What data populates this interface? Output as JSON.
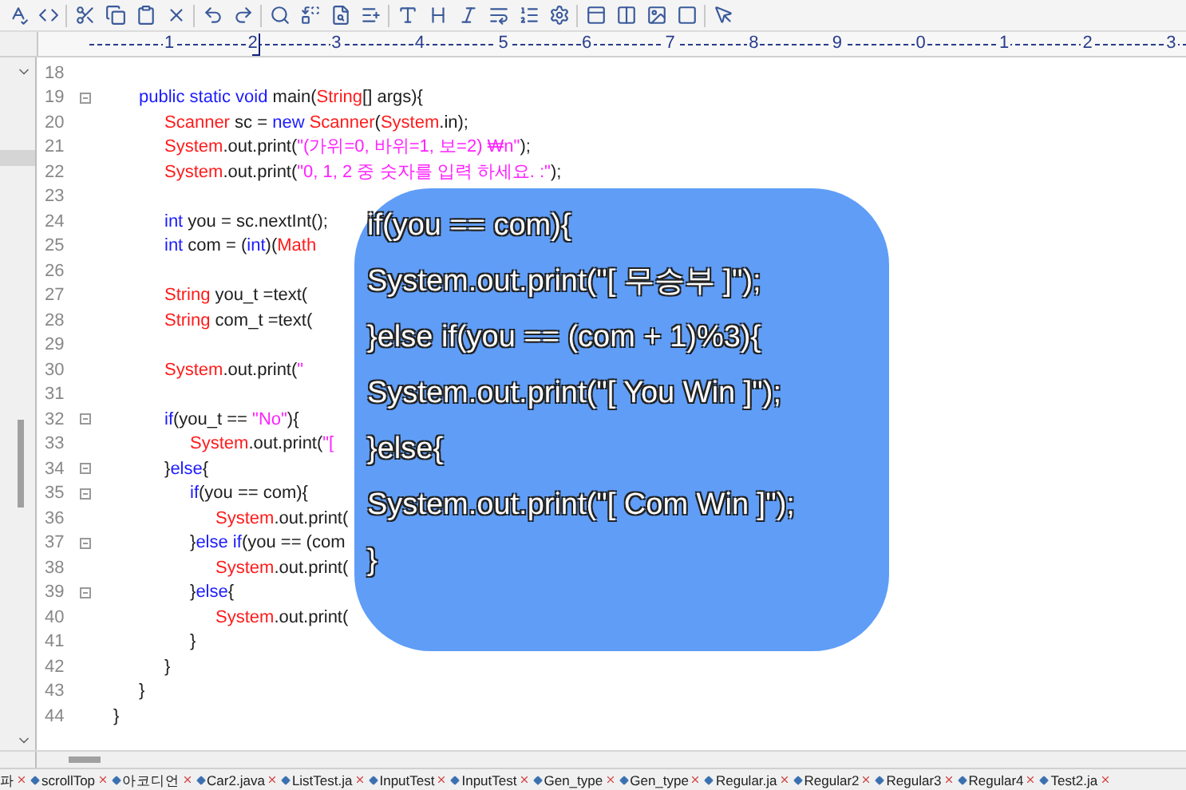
{
  "ruler": {
    "labels": [
      "1",
      "2",
      "3",
      "4",
      "5",
      "6",
      "7",
      "8",
      "9",
      "0",
      "1",
      "2",
      "3"
    ]
  },
  "code_lines": [
    {
      "number": "18",
      "fold": false
    },
    {
      "number": "19",
      "fold": true,
      "tokens": [
        {
          "kind": "keyword",
          "text": "\tpublic static void"
        },
        {
          "kind": "plain",
          "text": " main("
        },
        {
          "kind": "class",
          "text": "String"
        },
        {
          "kind": "plain",
          "text": "[] args){"
        }
      ]
    },
    {
      "number": "20",
      "fold": false,
      "tokens": [
        {
          "kind": "class",
          "text": "\t\tScanner"
        },
        {
          "kind": "plain",
          "text": " sc = "
        },
        {
          "kind": "keyword",
          "text": "new"
        },
        {
          "kind": "class",
          "text": " Scanner"
        },
        {
          "kind": "plain",
          "text": "("
        },
        {
          "kind": "class",
          "text": "System"
        },
        {
          "kind": "plain",
          "text": ".in);"
        }
      ]
    },
    {
      "number": "21",
      "fold": false,
      "tokens": [
        {
          "kind": "class",
          "text": "\t\tSystem"
        },
        {
          "kind": "plain",
          "text": ".out.print("
        },
        {
          "kind": "string",
          "text": "\"(가위=0, 바위=1, 보=2) ₩n\""
        },
        {
          "kind": "plain",
          "text": ");"
        }
      ]
    },
    {
      "number": "22",
      "fold": false,
      "tokens": [
        {
          "kind": "class",
          "text": "\t\tSystem"
        },
        {
          "kind": "plain",
          "text": ".out.print("
        },
        {
          "kind": "string",
          "text": "\"0, 1, 2 중 숫자를 입력 하세요. :\""
        },
        {
          "kind": "plain",
          "text": ");"
        }
      ]
    },
    {
      "number": "23",
      "fold": false
    },
    {
      "number": "24",
      "fold": false,
      "tokens": [
        {
          "kind": "keyword",
          "text": "\t\tint"
        },
        {
          "kind": "plain",
          "text": " you = sc.nextInt();"
        }
      ]
    },
    {
      "number": "25",
      "fold": false,
      "tokens": [
        {
          "kind": "keyword",
          "text": "\t\tint"
        },
        {
          "kind": "plain",
          "text": " com = ("
        },
        {
          "kind": "keyword",
          "text": "int"
        },
        {
          "kind": "plain",
          "text": ")("
        },
        {
          "kind": "class",
          "text": "Math"
        }
      ]
    },
    {
      "number": "26",
      "fold": false
    },
    {
      "number": "27",
      "fold": false,
      "tokens": [
        {
          "kind": "class",
          "text": "\t\tString"
        },
        {
          "kind": "plain",
          "text": " you_t =text("
        }
      ]
    },
    {
      "number": "28",
      "fold": false,
      "tokens": [
        {
          "kind": "class",
          "text": "\t\tString"
        },
        {
          "kind": "plain",
          "text": " com_t =text("
        }
      ]
    },
    {
      "number": "29",
      "fold": false
    },
    {
      "number": "30",
      "fold": false,
      "tokens": [
        {
          "kind": "class",
          "text": "\t\tSystem"
        },
        {
          "kind": "plain",
          "text": ".out.print("
        },
        {
          "kind": "string",
          "text": "\""
        }
      ]
    },
    {
      "number": "31",
      "fold": false
    },
    {
      "number": "32",
      "fold": true,
      "tokens": [
        {
          "kind": "keyword",
          "text": "\t\tif"
        },
        {
          "kind": "plain",
          "text": "(you_t == "
        },
        {
          "kind": "string",
          "text": "\"No\""
        },
        {
          "kind": "plain",
          "text": "){"
        }
      ]
    },
    {
      "number": "33",
      "fold": false,
      "tokens": [
        {
          "kind": "class",
          "text": "\t\t\tSystem"
        },
        {
          "kind": "plain",
          "text": ".out.print("
        },
        {
          "kind": "string",
          "text": "\"["
        }
      ]
    },
    {
      "number": "34",
      "fold": true,
      "tokens": [
        {
          "kind": "plain",
          "text": "\t\t}"
        },
        {
          "kind": "keyword",
          "text": "else"
        },
        {
          "kind": "plain",
          "text": "{"
        }
      ]
    },
    {
      "number": "35",
      "fold": true,
      "tokens": [
        {
          "kind": "keyword",
          "text": "\t\t\tif"
        },
        {
          "kind": "plain",
          "text": "(you == com){"
        }
      ]
    },
    {
      "number": "36",
      "fold": false,
      "tokens": [
        {
          "kind": "class",
          "text": "\t\t\t\tSystem"
        },
        {
          "kind": "plain",
          "text": ".out.print("
        }
      ]
    },
    {
      "number": "37",
      "fold": true,
      "tokens": [
        {
          "kind": "plain",
          "text": "\t\t\t}"
        },
        {
          "kind": "keyword",
          "text": "else if"
        },
        {
          "kind": "plain",
          "text": "(you == (com"
        }
      ]
    },
    {
      "number": "38",
      "fold": false,
      "tokens": [
        {
          "kind": "class",
          "text": "\t\t\t\tSystem"
        },
        {
          "kind": "plain",
          "text": ".out.print("
        }
      ]
    },
    {
      "number": "39",
      "fold": true,
      "tokens": [
        {
          "kind": "plain",
          "text": "\t\t\t}"
        },
        {
          "kind": "keyword",
          "text": "else"
        },
        {
          "kind": "plain",
          "text": "{"
        }
      ]
    },
    {
      "number": "40",
      "fold": false,
      "tokens": [
        {
          "kind": "class",
          "text": "\t\t\t\tSystem"
        },
        {
          "kind": "plain",
          "text": ".out.print("
        }
      ]
    },
    {
      "number": "41",
      "fold": false,
      "tokens": [
        {
          "kind": "plain",
          "text": "\t\t\t}"
        }
      ]
    },
    {
      "number": "42",
      "fold": false,
      "tokens": [
        {
          "kind": "plain",
          "text": "\t\t}"
        }
      ]
    },
    {
      "number": "43",
      "fold": false,
      "tokens": [
        {
          "kind": "plain",
          "text": "\t}"
        }
      ]
    },
    {
      "number": "44",
      "fold": false,
      "tokens": [
        {
          "kind": "plain",
          "text": "}"
        }
      ]
    }
  ],
  "callout": {
    "lines": [
      "if(you == com){",
      "System.out.print(\"[ 무승부 ]\");",
      "}else if(you == (com + 1)%3){",
      "System.out.print(\"[ You Win ]\");",
      "}else{",
      "System.out.print(\"[ Com Win ]\");",
      "}"
    ]
  },
  "file_tabs": [
    "파",
    "scrollTop",
    "아코디언",
    "Car2.java",
    "ListTest.ja",
    "InputTest",
    "InputTest",
    "Gen_type",
    "Gen_type",
    "Regular.ja",
    "Regular2",
    "Regular3",
    "Regular4",
    "Test2.ja"
  ]
}
